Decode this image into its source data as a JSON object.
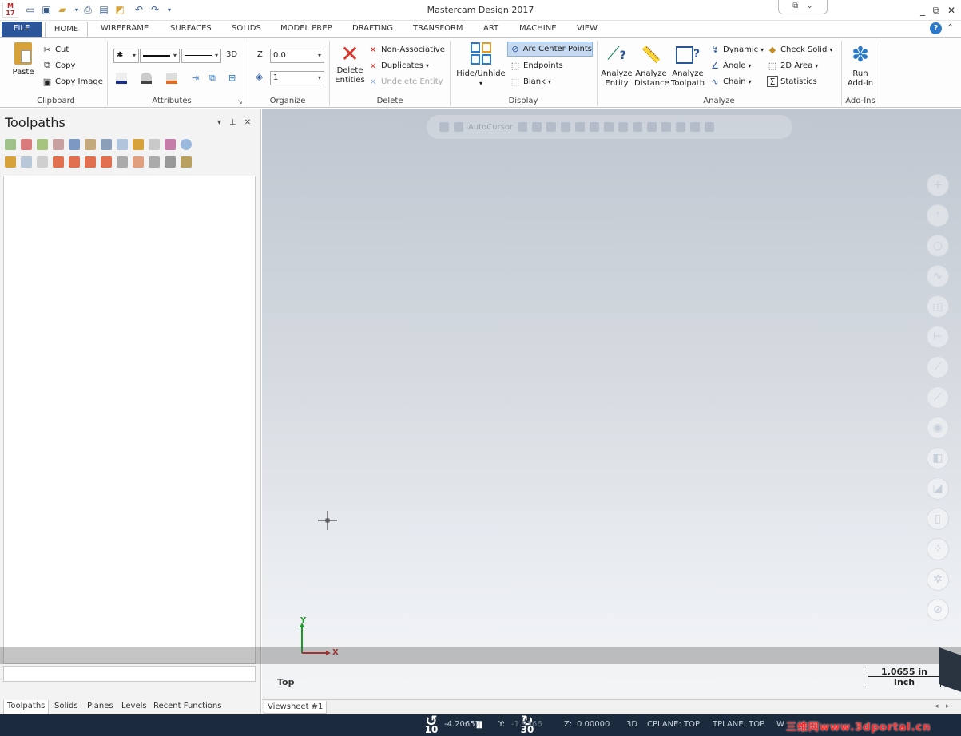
{
  "titlebar": {
    "app_title": "Mastercam Design 2017",
    "app_icon": "M 17",
    "qat_icons": [
      "new-file-icon",
      "save-icon",
      "open-folder-icon",
      "print-icon",
      "save-as-icon",
      "merge-icon",
      "undo-icon",
      "redo-icon",
      "customize-qat-icon"
    ],
    "window_controls": [
      "_",
      "⧉",
      "✕"
    ]
  },
  "tabs": [
    "FILE",
    "HOME",
    "WIREFRAME",
    "SURFACES",
    "SOLIDS",
    "MODEL PREP",
    "DRAFTING",
    "TRANSFORM",
    "ART",
    "MACHINE",
    "VIEW"
  ],
  "help_label": "?",
  "ribbon": {
    "clipboard": {
      "label": "Clipboard",
      "paste": "Paste",
      "cut": "Cut",
      "copy": "Copy",
      "copy_image": "Copy Image"
    },
    "attributes": {
      "label": "Attributes",
      "point_style": "✱",
      "three_d": "3D"
    },
    "organize": {
      "label": "Organize",
      "z_label": "Z",
      "z_value": "0.0",
      "level_value": "1"
    },
    "delete": {
      "label": "Delete",
      "delete_entities_l1": "Delete",
      "delete_entities_l2": "Entities",
      "non_associative": "Non-Associative",
      "duplicates": "Duplicates",
      "undelete_entity": "Undelete Entity"
    },
    "display": {
      "label": "Display",
      "hide_unhide": "Hide/Unhide",
      "arc_center_points": "Arc Center Points",
      "endpoints": "Endpoints",
      "blank": "Blank"
    },
    "analyze": {
      "label": "Analyze",
      "analyze_entity_l1": "Analyze",
      "analyze_entity_l2": "Entity",
      "analyze_distance_l1": "Analyze",
      "analyze_distance_l2": "Distance",
      "analyze_toolpath_l1": "Analyze",
      "analyze_toolpath_l2": "Toolpath",
      "dynamic": "Dynamic",
      "angle": "Angle",
      "chain": "Chain",
      "check_solid": "Check Solid",
      "area_2d": "2D Area",
      "statistics": "Statistics"
    },
    "addins": {
      "label": "Add-Ins",
      "run_addin_l1": "Run",
      "run_addin_l2": "Add-In"
    }
  },
  "panel": {
    "title": "Toolpaths",
    "controls": [
      "▾",
      "⊥",
      "✕"
    ],
    "bottom_tabs": [
      "Toolpaths",
      "Solids",
      "Planes",
      "Levels",
      "Recent Functions"
    ]
  },
  "viewport": {
    "autocursor_label": "AutoCursor",
    "axis_x": "X",
    "axis_y": "Y",
    "view_name": "Top",
    "scale_value": "1.0655 in",
    "scale_unit": "Inch",
    "viewsheet": "Viewsheet #1",
    "side_toolbar_icons": [
      "plus-icon",
      "point-icon",
      "circle-icon",
      "spline-icon",
      "box-icon",
      "dimension-icon",
      "ruler-icon",
      "ruler-alt-icon",
      "cylinder-icon",
      "cube-icon",
      "cube-color-icon",
      "level-icon",
      "grid-icon",
      "settings-icon",
      "no-icon"
    ]
  },
  "statusbar": {
    "rewind": "10",
    "pause": "⏸",
    "forward": "30",
    "x_value": "-4.20657",
    "y_label": "Y:",
    "y_value": "-1.9366",
    "z_label": "Z:",
    "z_value": "0.00000",
    "mode": "3D",
    "cplane": "CPLANE: TOP",
    "tplane": "TPLANE: TOP",
    "wcs": "W",
    "watermark": "三维网www.3dportal.cn"
  },
  "colors": {
    "file_tab": "#2b579a",
    "accent": "#2b79c9",
    "delete_red": "#d9342b",
    "statusbar": "#1b2a3d"
  }
}
